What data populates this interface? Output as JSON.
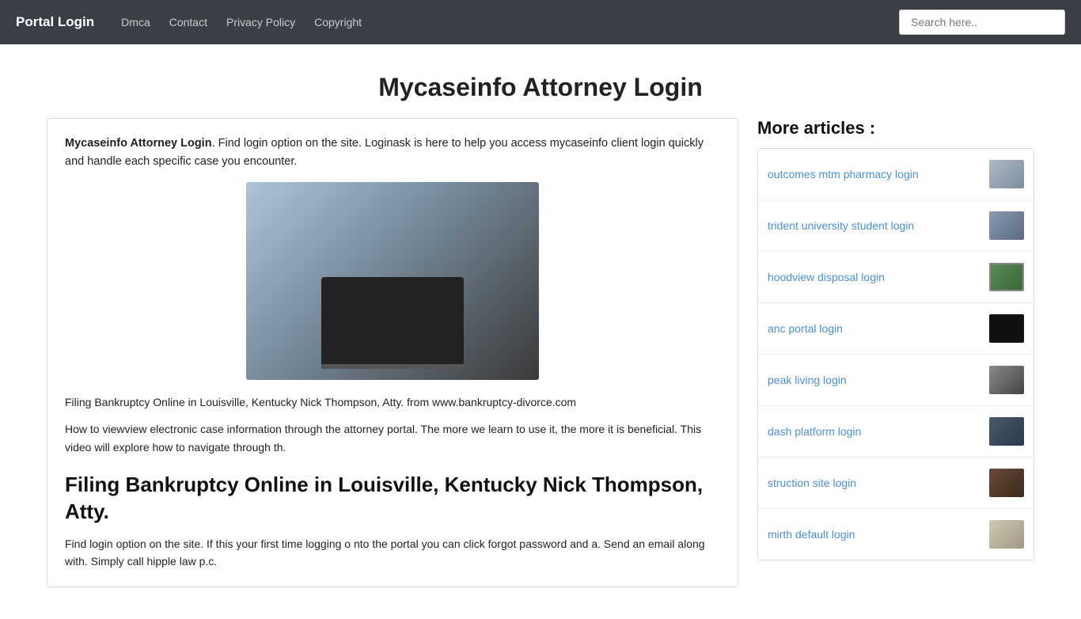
{
  "nav": {
    "brand": "Portal Login",
    "links": [
      "Dmca",
      "Contact",
      "Privacy Policy",
      "Copyright"
    ],
    "search_placeholder": "Search here.."
  },
  "page": {
    "title": "Mycaseinfo Attorney Login"
  },
  "main": {
    "intro_bold": "Mycaseinfo Attorney Login",
    "intro_text": ". Find login option on the site. Loginask is here to help you access mycaseinfo client login quickly and handle each specific case you encounter.",
    "caption_1": "Filing Bankruptcy Online in Louisville, Kentucky Nick Thompson, Atty. from www.bankruptcy-divorce.com",
    "caption_2": "How to viewview electronic case information through the attorney portal. The more we learn to use it, the more it is beneficial. This video will explore how to navigate through th.",
    "section_heading": "Filing Bankruptcy Online in Louisville, Kentucky Nick Thompson, Atty.",
    "section_body": "Find login option on the site. If this your first time logging o nto the portal you can click forgot password and a. Send an email along with. Simply call hipple law p.c."
  },
  "sidebar": {
    "more_title": "More articles :",
    "articles": [
      {
        "label": "outcomes mtm pharmacy login",
        "thumb_class": "thumb-1"
      },
      {
        "label": "trident university student login",
        "thumb_class": "thumb-2"
      },
      {
        "label": "hoodview disposal login",
        "thumb_class": "thumb-3"
      },
      {
        "label": "anc portal login",
        "thumb_class": "thumb-4"
      },
      {
        "label": "peak living login",
        "thumb_class": "thumb-5"
      },
      {
        "label": "dash platform login",
        "thumb_class": "thumb-6"
      },
      {
        "label": "struction site login",
        "thumb_class": "thumb-7"
      },
      {
        "label": "mirth default login",
        "thumb_class": "thumb-8"
      }
    ]
  }
}
